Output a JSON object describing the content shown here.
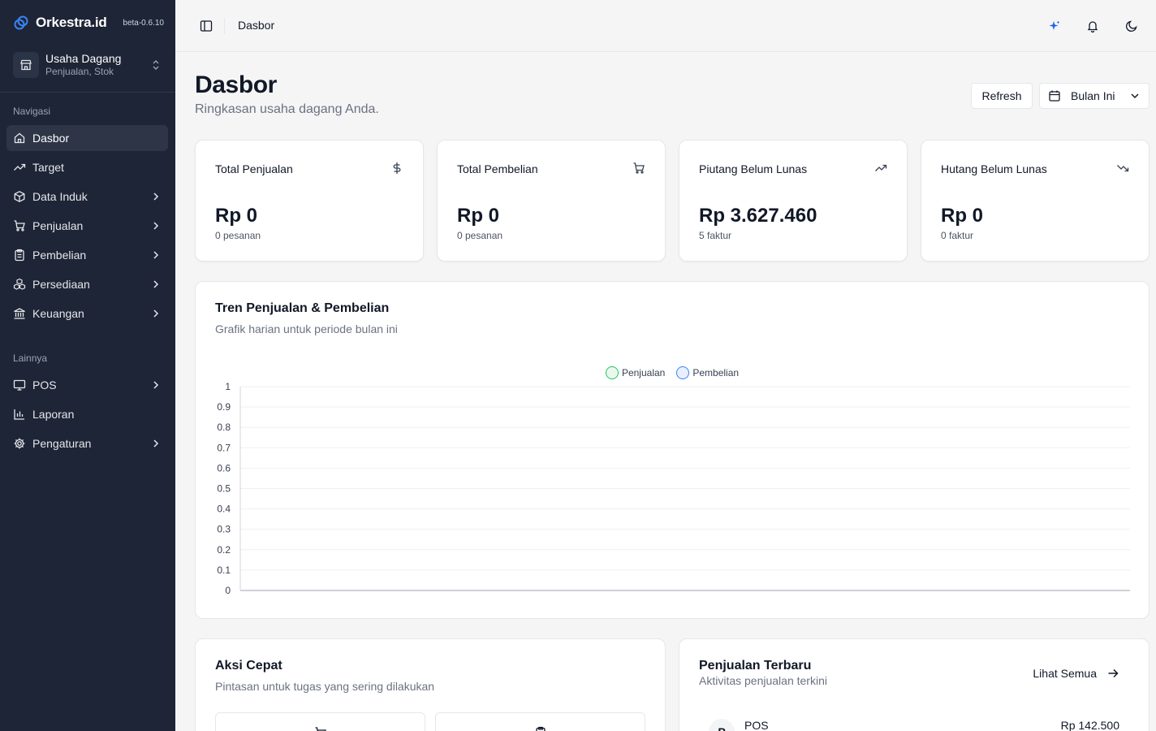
{
  "sidebar": {
    "brand": "Orkestra.id",
    "version": "beta-0.6.10",
    "workspace": {
      "title": "Usaha Dagang",
      "subtitle": "Penjualan, Stok"
    },
    "section_nav": "Navigasi",
    "section_other": "Lainnya",
    "items": [
      {
        "label": "Dasbor",
        "icon": "home-icon",
        "active": true,
        "has_children": false
      },
      {
        "label": "Target",
        "icon": "trending-up-icon",
        "active": false,
        "has_children": false
      },
      {
        "label": "Data Induk",
        "icon": "package-icon",
        "active": false,
        "has_children": true
      },
      {
        "label": "Penjualan",
        "icon": "shopping-cart-icon",
        "active": false,
        "has_children": true
      },
      {
        "label": "Pembelian",
        "icon": "clipboard-icon",
        "active": false,
        "has_children": true
      },
      {
        "label": "Persediaan",
        "icon": "boxes-icon",
        "active": false,
        "has_children": true
      },
      {
        "label": "Keuangan",
        "icon": "bank-icon",
        "active": false,
        "has_children": true
      }
    ],
    "other_items": [
      {
        "label": "POS",
        "icon": "monitor-icon",
        "has_children": true
      },
      {
        "label": "Laporan",
        "icon": "bar-chart-icon",
        "has_children": false
      },
      {
        "label": "Pengaturan",
        "icon": "gear-icon",
        "has_children": true
      }
    ]
  },
  "header": {
    "title": "Dasbor",
    "icons": [
      "sparkles-icon",
      "bell-icon",
      "moon-icon"
    ]
  },
  "page": {
    "title": "Dasbor",
    "subtitle": "Ringkasan usaha dagang Anda.",
    "refresh_label": "Refresh",
    "period_label": "Bulan Ini"
  },
  "stats": [
    {
      "label": "Total Penjualan",
      "value": "Rp 0",
      "sub": "0 pesanan",
      "icon": "dollar-icon"
    },
    {
      "label": "Total Pembelian",
      "value": "Rp 0",
      "sub": "0 pesanan",
      "icon": "shopping-cart-icon"
    },
    {
      "label": "Piutang Belum Lunas",
      "value": "Rp 3.627.460",
      "sub": "5 faktur",
      "icon": "trending-up-icon"
    },
    {
      "label": "Hutang Belum Lunas",
      "value": "Rp 0",
      "sub": "0 faktur",
      "icon": "trending-down-icon"
    }
  ],
  "trend": {
    "title": "Tren Penjualan & Pembelian",
    "subtitle": "Grafik harian untuk periode bulan ini"
  },
  "chart_data": {
    "type": "line",
    "title": "",
    "xlabel": "",
    "ylabel": "",
    "ylim": [
      0,
      1
    ],
    "yticks": [
      "0",
      "0.1",
      "0.2",
      "0.3",
      "0.4",
      "0.5",
      "0.6",
      "0.7",
      "0.8",
      "0.9",
      "1"
    ],
    "grid": true,
    "legend_position": "top-center",
    "series": [
      {
        "name": "Penjualan",
        "color": "#22c55e",
        "values": []
      },
      {
        "name": "Pembelian",
        "color": "#3b82f6",
        "values": []
      }
    ]
  },
  "quick_actions": {
    "title": "Aksi Cepat",
    "subtitle": "Pintasan untuk tugas yang sering dilakukan",
    "buttons": [
      {
        "icon": "shopping-cart-icon"
      },
      {
        "icon": "clipboard-icon"
      }
    ]
  },
  "recent_sales": {
    "title": "Penjualan Terbaru",
    "subtitle": "Aktivitas penjualan terkini",
    "see_all": "Lihat Semua",
    "rows": [
      {
        "avatar": "P",
        "name": "POS",
        "amount": "Rp 142.500"
      }
    ]
  },
  "colors": {
    "sidebar_bg": "#1e2536",
    "accent": "#2563eb",
    "page_bg": "#f5f5f6"
  }
}
